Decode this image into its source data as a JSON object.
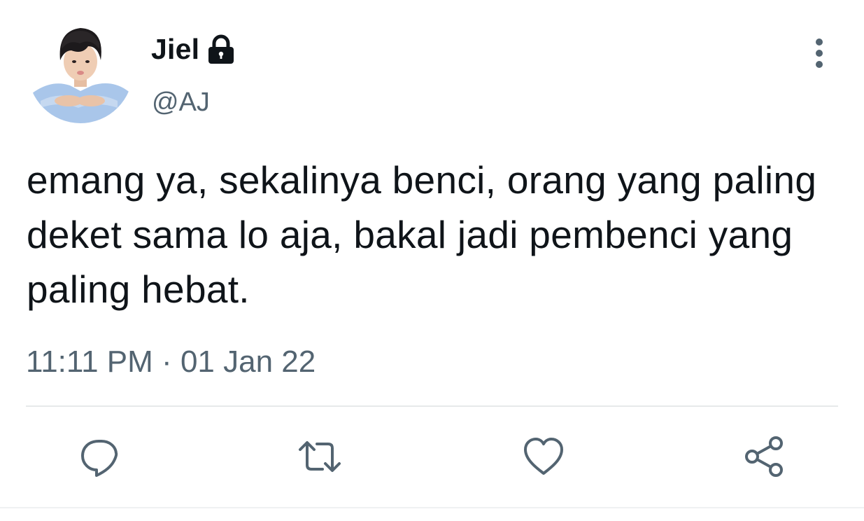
{
  "tweet": {
    "display_name": "Jiel",
    "handle": "@AJ",
    "text": "emang ya, sekalinya benci, orang yang paling deket sama lo aja, bakal jadi pembenci yang paling hebat.",
    "time": "11:11 PM",
    "separator": "·",
    "date": "01 Jan 22",
    "protected_icon": "lock-icon",
    "more_icon": "more-vertical-icon"
  },
  "actions": [
    {
      "name": "reply",
      "icon": "reply-icon"
    },
    {
      "name": "retweet",
      "icon": "retweet-icon"
    },
    {
      "name": "like",
      "icon": "heart-icon"
    },
    {
      "name": "share",
      "icon": "share-icon"
    }
  ],
  "colors": {
    "text": "#0f1419",
    "secondary": "#536471",
    "divider": "#e7e9ea",
    "background": "#ffffff"
  }
}
